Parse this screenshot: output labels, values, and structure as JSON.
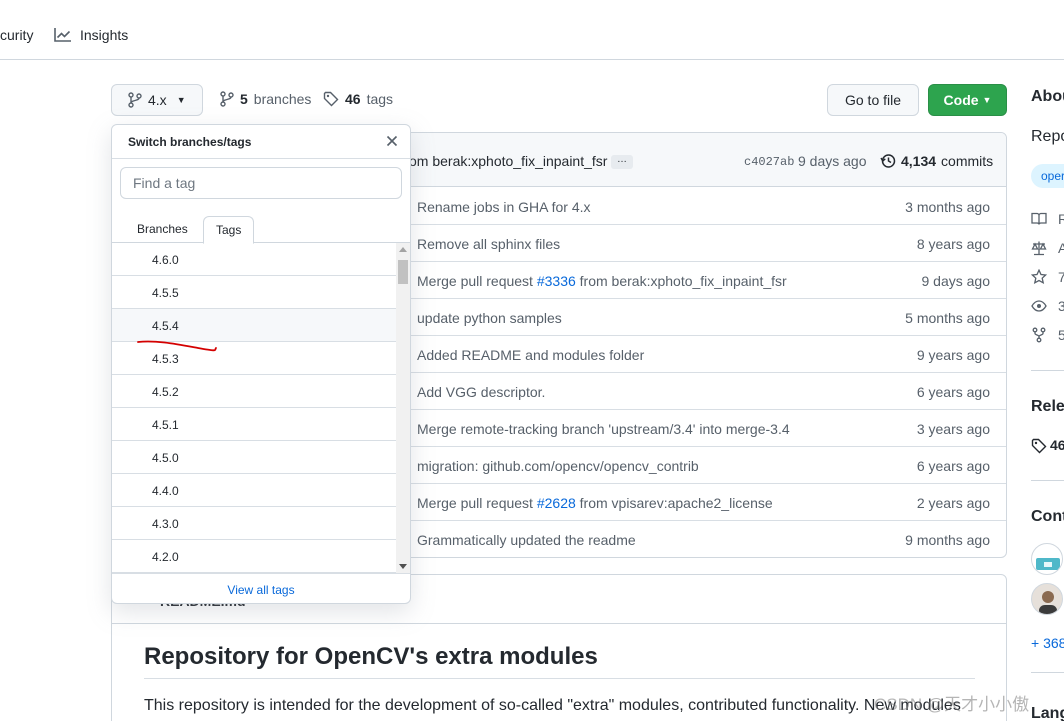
{
  "topnav": {
    "security_label": "curity",
    "insights_label": "Insights"
  },
  "branchbar": {
    "branch_name": "4.x",
    "branches_count": "5",
    "branches_label": "branches",
    "tags_count": "46",
    "tags_label": "tags",
    "go_to_file_label": "Go to file",
    "code_label": "Code"
  },
  "commit_header": {
    "message": "om berak:xphoto_fix_inpaint_fsr",
    "ellipsis": "…",
    "sha": "c4027ab",
    "when": "9 days ago",
    "commits_count": "4,134",
    "commits_label": "commits"
  },
  "commits": [
    {
      "pre": "Rename jobs in GHA for 4.x",
      "link": "",
      "post": "",
      "age": "3 months ago"
    },
    {
      "pre": "Remove all sphinx files",
      "link": "",
      "post": "",
      "age": "8 years ago"
    },
    {
      "pre": "Merge pull request ",
      "link": "#3336",
      "post": " from berak:xphoto_fix_inpaint_fsr",
      "age": "9 days ago"
    },
    {
      "pre": "update python samples",
      "link": "",
      "post": "",
      "age": "5 months ago"
    },
    {
      "pre": "Added README and modules folder",
      "link": "",
      "post": "",
      "age": "9 years ago"
    },
    {
      "pre": "Add VGG descriptor.",
      "link": "",
      "post": "",
      "age": "6 years ago"
    },
    {
      "pre": "Merge remote-tracking branch 'upstream/3.4' into merge-3.4",
      "link": "",
      "post": "",
      "age": "3 years ago"
    },
    {
      "pre": "migration: github.com/opencv/opencv_contrib",
      "link": "",
      "post": "",
      "age": "6 years ago"
    },
    {
      "pre": "Merge pull request ",
      "link": "#2628",
      "post": " from vpisarev:apache2_license",
      "age": "2 years ago"
    },
    {
      "pre": "Grammatically updated the readme",
      "link": "",
      "post": "",
      "age": "9 months ago"
    }
  ],
  "readme": {
    "header_title": "README.md",
    "heading": "Repository for OpenCV's extra modules",
    "paragraph": "This repository is intended for the development of so-called \"extra\" modules, contributed functionality. New modules"
  },
  "sidebar": {
    "about": "Abou",
    "description": "Repo",
    "topic": "oper",
    "stats": [
      "R",
      "A",
      "7",
      "3",
      "5"
    ],
    "releases": "Relea",
    "releases_count": "46",
    "contributors": "Cont",
    "more_contributors": "+ 368",
    "languages": "Lang"
  },
  "dropdown": {
    "title": "Switch branches/tags",
    "filter_placeholder": "Find a tag",
    "tab_branches": "Branches",
    "tab_tags": "Tags",
    "tags": [
      "4.6.0",
      "4.5.5",
      "4.5.4",
      "4.5.3",
      "4.5.2",
      "4.5.1",
      "4.5.0",
      "4.4.0",
      "4.3.0",
      "4.2.0"
    ],
    "hovered_tag": "4.5.4",
    "view_all": "View all tags"
  },
  "watermark": "CSDN @天才小小傲",
  "colors": {
    "primary_green": "#2da44e",
    "link_blue": "#0969da",
    "border": "#d0d7de",
    "annotation_red": "#d40000"
  }
}
